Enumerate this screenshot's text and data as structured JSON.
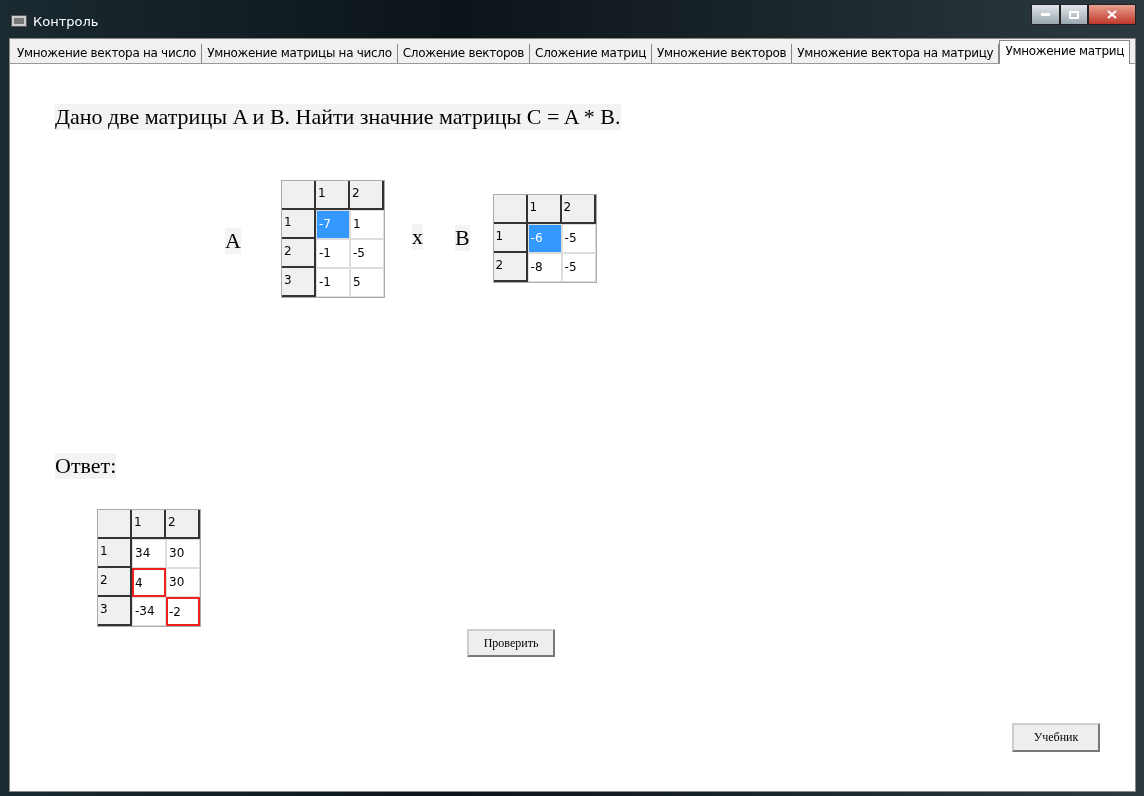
{
  "window": {
    "title": "Контроль"
  },
  "tabs": [
    {
      "label": "Умножение вектора на число",
      "selected": false
    },
    {
      "label": "Умножение матрицы на число",
      "selected": false
    },
    {
      "label": "Сложение векторов",
      "selected": false
    },
    {
      "label": "Сложение матриц",
      "selected": false
    },
    {
      "label": "Умножение векторов",
      "selected": false
    },
    {
      "label": "Умножение вектора на матрицу",
      "selected": false
    },
    {
      "label": "Умножение матриц",
      "selected": true
    }
  ],
  "task": "Дано две матрицы A и B. Найти значние матрицы C = A * B.",
  "matrix_a": {
    "label": "A",
    "columns": [
      "1",
      "2"
    ],
    "rows": [
      {
        "header": "1",
        "cells": [
          {
            "value": "-7",
            "selected": true,
            "invalid": false
          },
          {
            "value": "1",
            "selected": false,
            "invalid": false
          }
        ]
      },
      {
        "header": "2",
        "cells": [
          {
            "value": "-1",
            "selected": false,
            "invalid": false
          },
          {
            "value": "-5",
            "selected": false,
            "invalid": false
          }
        ]
      },
      {
        "header": "3",
        "cells": [
          {
            "value": "-1",
            "selected": false,
            "invalid": false
          },
          {
            "value": "5",
            "selected": false,
            "invalid": false
          }
        ]
      }
    ]
  },
  "operator": "x",
  "matrix_b": {
    "label": "B",
    "columns": [
      "1",
      "2"
    ],
    "rows": [
      {
        "header": "1",
        "cells": [
          {
            "value": "-6",
            "selected": true,
            "invalid": false
          },
          {
            "value": "-5",
            "selected": false,
            "invalid": false
          }
        ]
      },
      {
        "header": "2",
        "cells": [
          {
            "value": "-8",
            "selected": false,
            "invalid": false
          },
          {
            "value": "-5",
            "selected": false,
            "invalid": false
          }
        ]
      }
    ]
  },
  "answer_label": "Ответ:",
  "answer": {
    "columns": [
      "1",
      "2"
    ],
    "rows": [
      {
        "header": "1",
        "cells": [
          {
            "value": "34",
            "selected": false,
            "invalid": false
          },
          {
            "value": "30",
            "selected": false,
            "invalid": false
          }
        ]
      },
      {
        "header": "2",
        "cells": [
          {
            "value": "4",
            "selected": false,
            "invalid": true
          },
          {
            "value": "30",
            "selected": false,
            "invalid": false
          }
        ]
      },
      {
        "header": "3",
        "cells": [
          {
            "value": "-34",
            "selected": false,
            "invalid": false
          },
          {
            "value": "-2",
            "selected": false,
            "invalid": true
          }
        ]
      }
    ]
  },
  "check_button": "Проверить",
  "textbook_button": "Учебник"
}
